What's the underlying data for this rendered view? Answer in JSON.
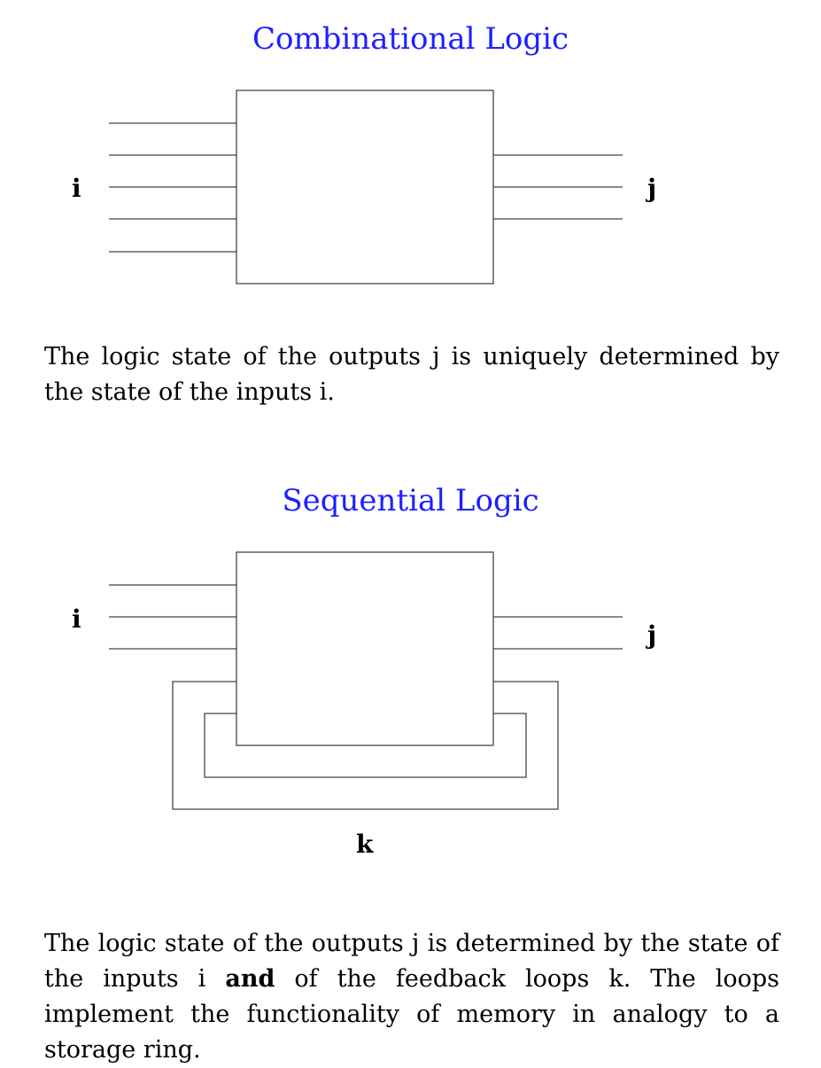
{
  "combinational": {
    "title": "Combinational Logic",
    "input_label": "i",
    "output_label": "j",
    "description": "The logic state of the outputs j is uniquely determined by the state of the inputs i."
  },
  "sequential": {
    "title": "Sequential Logic",
    "input_label": "i",
    "output_label": "j",
    "feedback_label": "k",
    "description_pre": "The logic state of the outputs j is determined by the state of the inputs i ",
    "description_bold": "and",
    "description_post": " of the feedback loops k. The loops implement the functionality of memory in analogy to a storage ring."
  }
}
